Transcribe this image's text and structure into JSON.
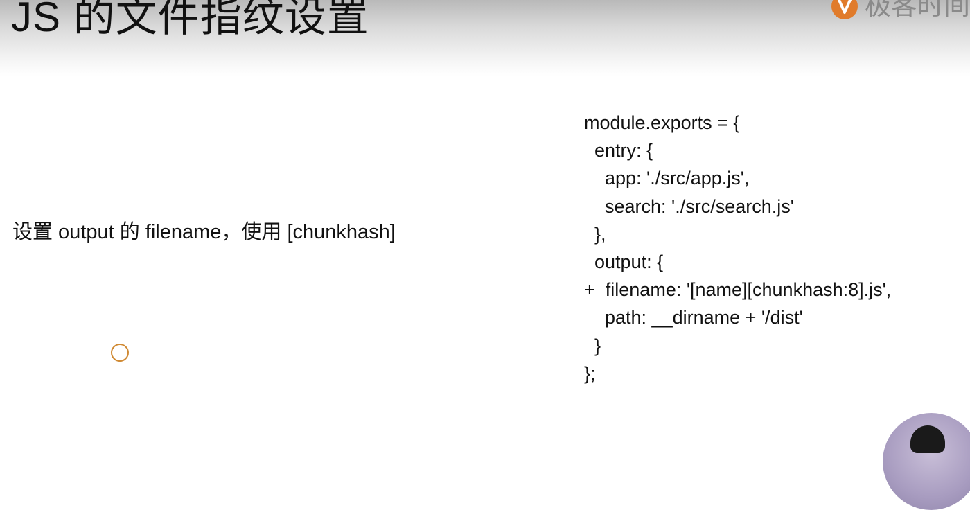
{
  "slide": {
    "title": "JS 的文件指纹设置",
    "brand": {
      "name": "极客时间",
      "icon": "geektime-logo-icon",
      "color": "#e07b2b"
    }
  },
  "description": "设置 output 的 filename，使用 [chunkhash]",
  "code": {
    "lines": [
      "module.exports = {",
      "  entry: {",
      "    app: './src/app.js',",
      "    search: './src/search.js'",
      "  },",
      "  output: {",
      "+  filename: '[name][chunkhash:8].js',",
      "    path: __dirname + '/dist'",
      "  }",
      "};"
    ]
  },
  "cursor": {
    "icon": "cursor-ring-icon",
    "color": "#d08a34"
  }
}
